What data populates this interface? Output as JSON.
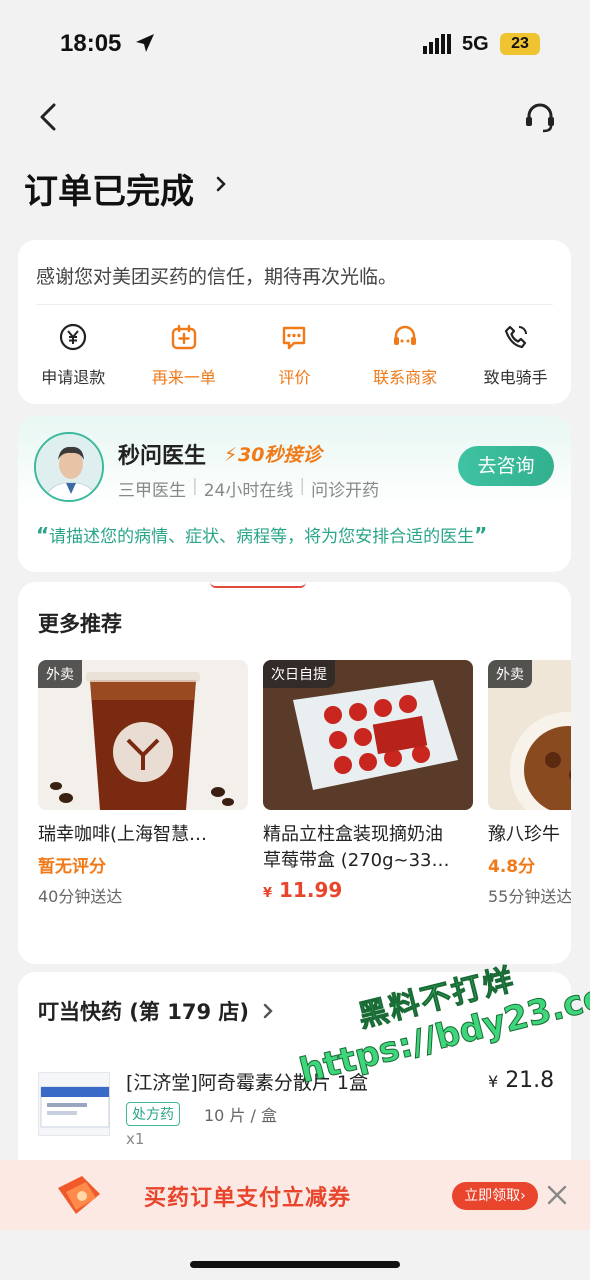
{
  "status_bar": {
    "time": "18:05",
    "network": "5G",
    "battery": "23"
  },
  "header": {
    "title": "订单已完成"
  },
  "thanks": {
    "message": "感谢您对美团买药的信任，期待再次光临。",
    "actions": [
      {
        "label": "申请退款",
        "icon": "refund-icon"
      },
      {
        "label": "再来一单",
        "icon": "reorder-icon"
      },
      {
        "label": "评价",
        "icon": "review-icon"
      },
      {
        "label": "联系商家",
        "icon": "contact-merchant-icon"
      },
      {
        "label": "致电骑手",
        "icon": "call-rider-icon"
      }
    ]
  },
  "doctor": {
    "name": "秒问医生",
    "fast_badge": "30秒接诊",
    "meta": [
      "三甲医生",
      "24小时在线",
      "问诊开药"
    ],
    "consult_label": "去咨询",
    "quote_open": "“",
    "quote": "请描述您的病情、症状、病程等，将为您安排合适的医生",
    "quote_close": "”"
  },
  "recommend": {
    "title": "更多推荐",
    "items": [
      {
        "tag": "外卖",
        "name": "瑞幸咖啡(上海智慧…",
        "rating": "暂无评分",
        "delivery": "40分钟送达"
      },
      {
        "tag": "次日自提",
        "name_line1": "精品立柱盒装现摘奶油",
        "name_line2": "草莓带盒 (270g~33…",
        "currency": "¥",
        "price": "11.99"
      },
      {
        "tag": "外卖",
        "name": "豫八珍牛",
        "rating": "4.8分",
        "delivery": "55分钟送达"
      }
    ]
  },
  "store": {
    "title": "叮当快药 (第 179 店)",
    "product": {
      "name": "[江济堂]阿奇霉素分散片 1盒",
      "rx_badge": "处方药",
      "spec": "10 片 / 盒",
      "qty": "x1",
      "currency": "¥",
      "price": "21.8"
    }
  },
  "watermark": {
    "line1": "黑料不打烊",
    "line2": "https://bdy23.co"
  },
  "coupon": {
    "text": "买药订单支付立减券",
    "button": "立即领取›"
  },
  "colors": {
    "accent_orange": "#f07a18",
    "accent_green": "#32b08f",
    "price_red": "#e8452c"
  }
}
